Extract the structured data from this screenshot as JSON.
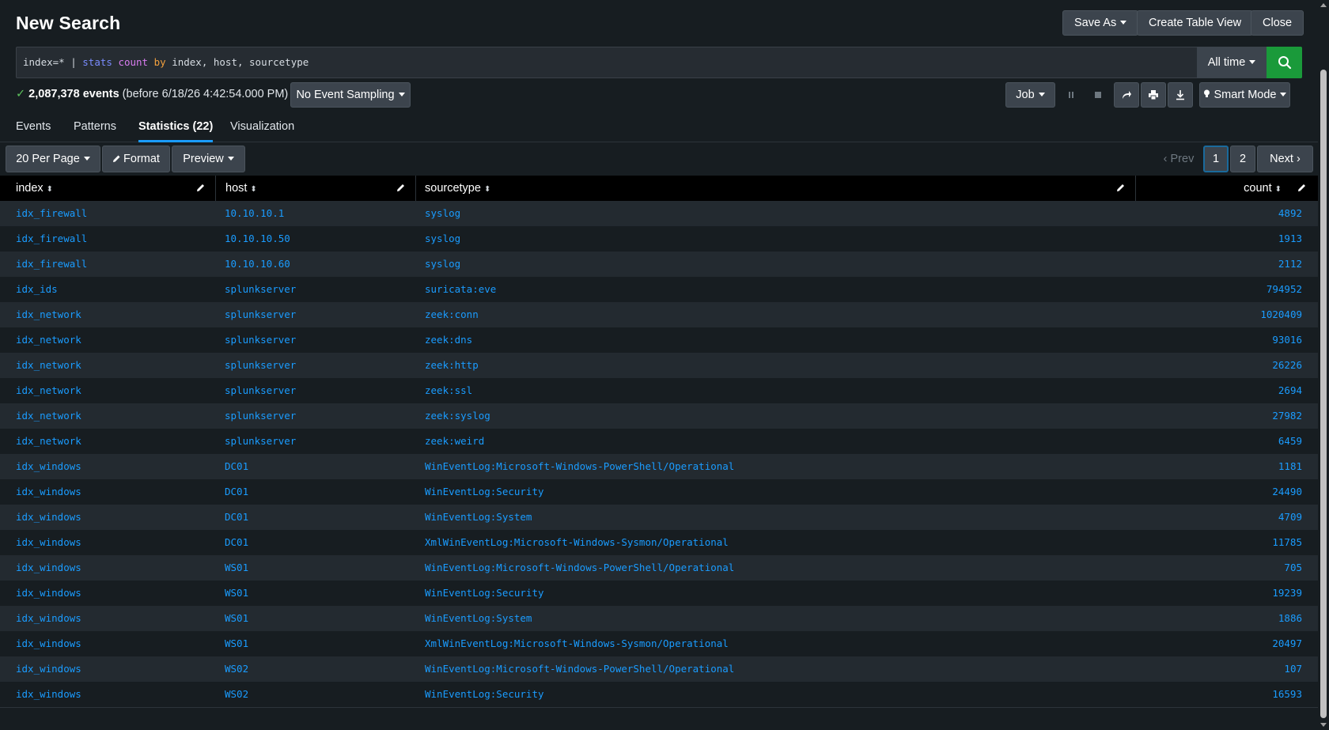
{
  "header": {
    "title": "New Search",
    "save_as_label": "Save As",
    "create_table_view_label": "Create Table View",
    "close_label": "Close"
  },
  "search": {
    "query_index": "index=* | ",
    "query_cmd": "stats",
    "query_fn": "count",
    "query_kw": "by",
    "query_fields": " index, host, sourcetype",
    "time_range": "All time"
  },
  "status": {
    "event_count": "2,087,378 events",
    "before_text": "(before 6/18/26 4:42:54.000 PM)",
    "sampling": "No Event Sampling",
    "job_label": "Job",
    "mode": "Smart Mode"
  },
  "tabs": [
    {
      "label": "Events"
    },
    {
      "label": "Patterns"
    },
    {
      "label": "Statistics (22)"
    },
    {
      "label": "Visualization"
    }
  ],
  "toolbar": {
    "per_page": "20 Per Page",
    "format": "Format",
    "preview": "Preview"
  },
  "pager": {
    "prev": "Prev",
    "pages": [
      "1",
      "2"
    ],
    "next": "Next"
  },
  "table": {
    "columns": [
      "index",
      "host",
      "sourcetype",
      "count"
    ],
    "rows": [
      [
        "idx_firewall",
        "10.10.10.1",
        "syslog",
        "4892"
      ],
      [
        "idx_firewall",
        "10.10.10.50",
        "syslog",
        "1913"
      ],
      [
        "idx_firewall",
        "10.10.10.60",
        "syslog",
        "2112"
      ],
      [
        "idx_ids",
        "splunkserver",
        "suricata:eve",
        "794952"
      ],
      [
        "idx_network",
        "splunkserver",
        "zeek:conn",
        "1020409"
      ],
      [
        "idx_network",
        "splunkserver",
        "zeek:dns",
        "93016"
      ],
      [
        "idx_network",
        "splunkserver",
        "zeek:http",
        "26226"
      ],
      [
        "idx_network",
        "splunkserver",
        "zeek:ssl",
        "2694"
      ],
      [
        "idx_network",
        "splunkserver",
        "zeek:syslog",
        "27982"
      ],
      [
        "idx_network",
        "splunkserver",
        "zeek:weird",
        "6459"
      ],
      [
        "idx_windows",
        "DC01",
        "WinEventLog:Microsoft-Windows-PowerShell/Operational",
        "1181"
      ],
      [
        "idx_windows",
        "DC01",
        "WinEventLog:Security",
        "24490"
      ],
      [
        "idx_windows",
        "DC01",
        "WinEventLog:System",
        "4709"
      ],
      [
        "idx_windows",
        "DC01",
        "XmlWinEventLog:Microsoft-Windows-Sysmon/Operational",
        "11785"
      ],
      [
        "idx_windows",
        "WS01",
        "WinEventLog:Microsoft-Windows-PowerShell/Operational",
        "705"
      ],
      [
        "idx_windows",
        "WS01",
        "WinEventLog:Security",
        "19239"
      ],
      [
        "idx_windows",
        "WS01",
        "WinEventLog:System",
        "1886"
      ],
      [
        "idx_windows",
        "WS01",
        "XmlWinEventLog:Microsoft-Windows-Sysmon/Operational",
        "20497"
      ],
      [
        "idx_windows",
        "WS02",
        "WinEventLog:Microsoft-Windows-PowerShell/Operational",
        "107"
      ],
      [
        "idx_windows",
        "WS02",
        "WinEventLog:Security",
        "16593"
      ]
    ]
  },
  "colors": {
    "background": "#171d21",
    "link": "#1a9cff",
    "accent_green": "#1a9a3a",
    "active_tab_underline": "#1a9cff"
  },
  "icons": {
    "search": "search-icon",
    "pause": "pause-icon",
    "stop": "stop-icon",
    "share": "share-icon",
    "print": "print-icon",
    "export": "download-icon",
    "mode": "lightbulb-icon",
    "format": "pencil-icon",
    "column_edit": "pencil-icon",
    "sort": "sort-icon"
  }
}
